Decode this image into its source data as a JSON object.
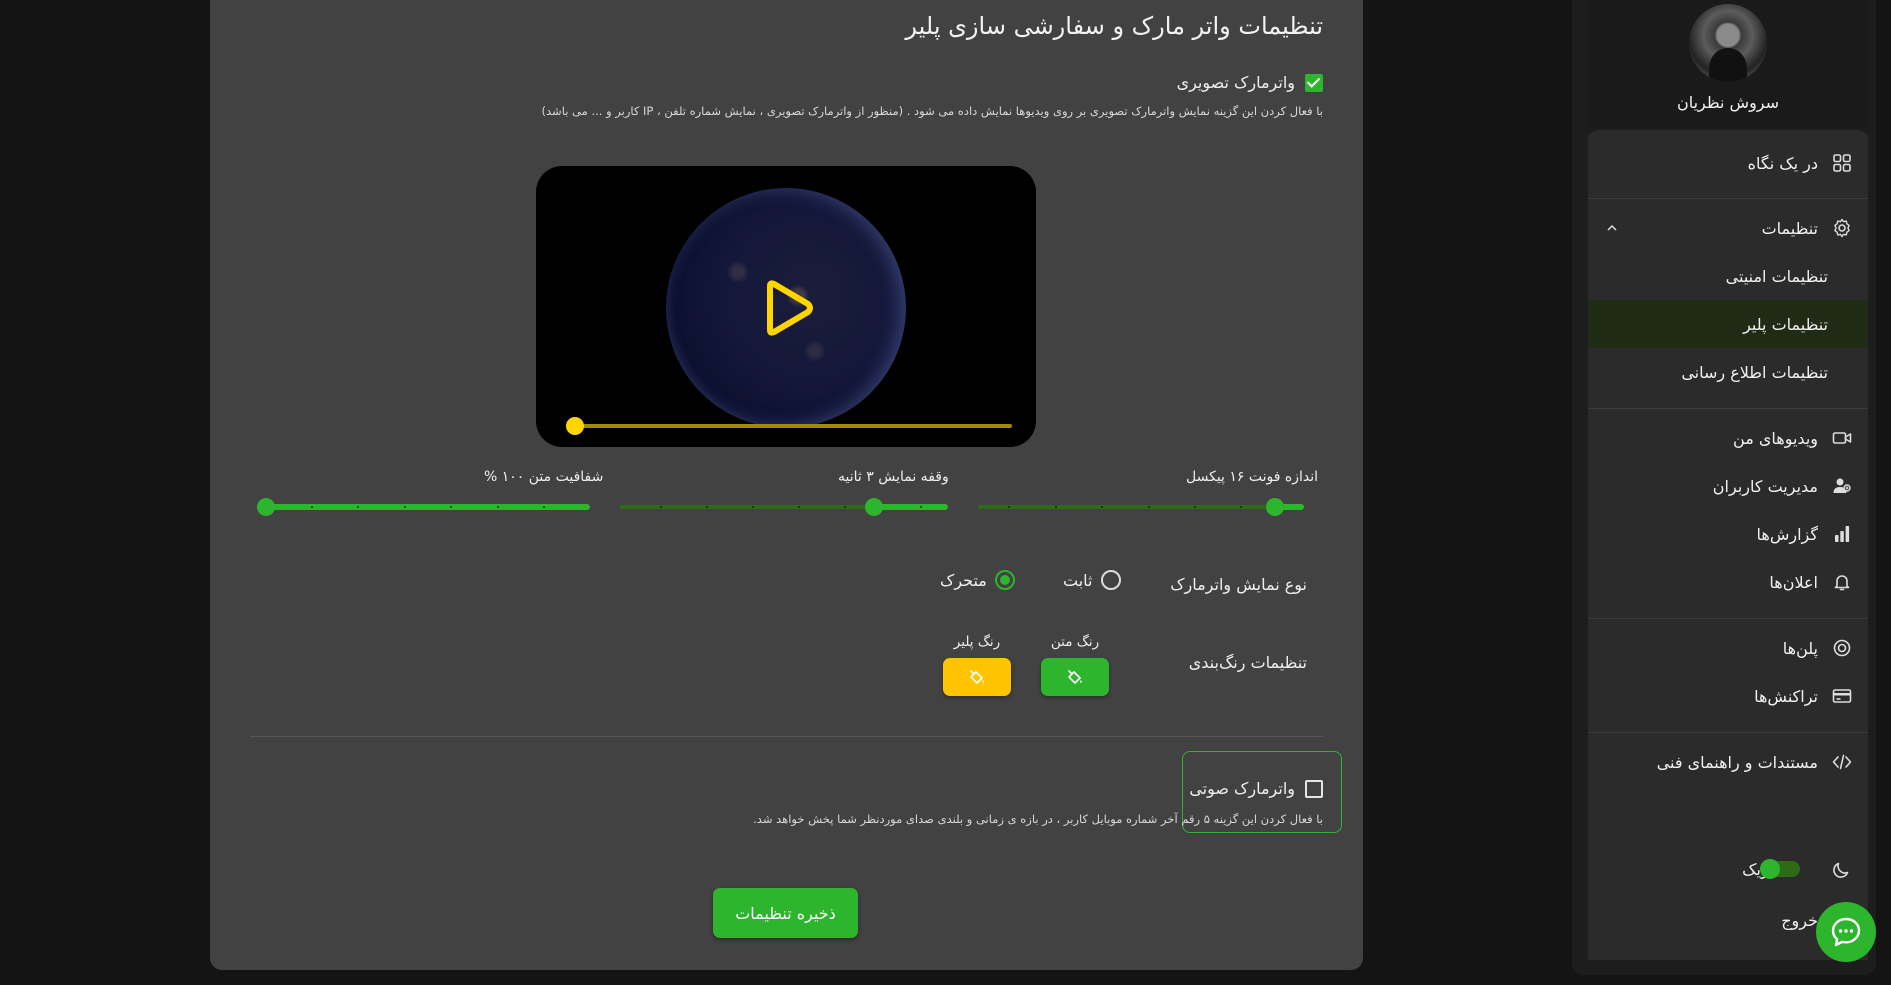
{
  "main": {
    "title": "تنظیمات واتر مارک و سفارشی سازی پلیر",
    "image_watermark": {
      "label": "واترمارک تصویری",
      "checked": true,
      "hint": "با فعال کردن این گزینه نمایش واترمارک تصویری بر روی ویدیوها نمایش داده می شود . (منظور از واترمارک تصویری ، نمایش شماره تلفن ، IP کاربر و ... می باشد)"
    },
    "video": {
      "progress": 0.0
    },
    "sliders": {
      "font_size": {
        "label": "اندازه فونت ۱۶ پیکسل",
        "value": 16
      },
      "display_interval": {
        "label": "وقفه نمایش ۳ ثانیه",
        "value": 3
      },
      "text_opacity": {
        "label": "شفافیت متن ۱۰۰ %",
        "value": 100
      }
    },
    "watermark_type": {
      "label": "نوع نمایش واترمارک",
      "options": [
        {
          "label": "ثابت",
          "selected": false
        },
        {
          "label": "متحرک",
          "selected": true
        }
      ]
    },
    "colors": {
      "title": "تنظیمات رنگ‌بندی",
      "text_color": {
        "label": "رنگ متن",
        "value": "#2db52d"
      },
      "player_color": {
        "label": "رنگ پلیر",
        "value": "#ffc400"
      }
    },
    "audio_watermark": {
      "label": "واترمارک صوتی",
      "checked": false,
      "hint": "با فعال کردن این گزینه ۵ رقم آخر شماره موبایل کاربر ، در بازه ی زمانی و بلندی صدای موردنظر شما پخش خواهد شد."
    },
    "save_label": "ذخیره تنظیمات"
  },
  "sidebar": {
    "user_name": "سروش نظریان",
    "items": {
      "overview": "در یک نگاه",
      "settings": "تنظیمات",
      "security_settings": "تنظیمات امنیتی",
      "player_settings": "تنظیمات پلیر",
      "notification_settings": "تنظیمات اطلاع رسانی",
      "my_videos": "ویدیوهای من",
      "user_management": "مدیریت کاربران",
      "reports": "گزارش‌ها",
      "announcements": "اعلان‌ها",
      "plans": "پلن‌ها",
      "transactions": "تراکنش‌ها",
      "docs": "مستندات و راهنمای فنی"
    },
    "dark_mode": {
      "label": "تاریک",
      "on": true
    },
    "logout": "خروج"
  },
  "colors": {
    "accent": "#2db52d",
    "player": "#ffc400",
    "background": "#141414",
    "card": "#424242"
  }
}
